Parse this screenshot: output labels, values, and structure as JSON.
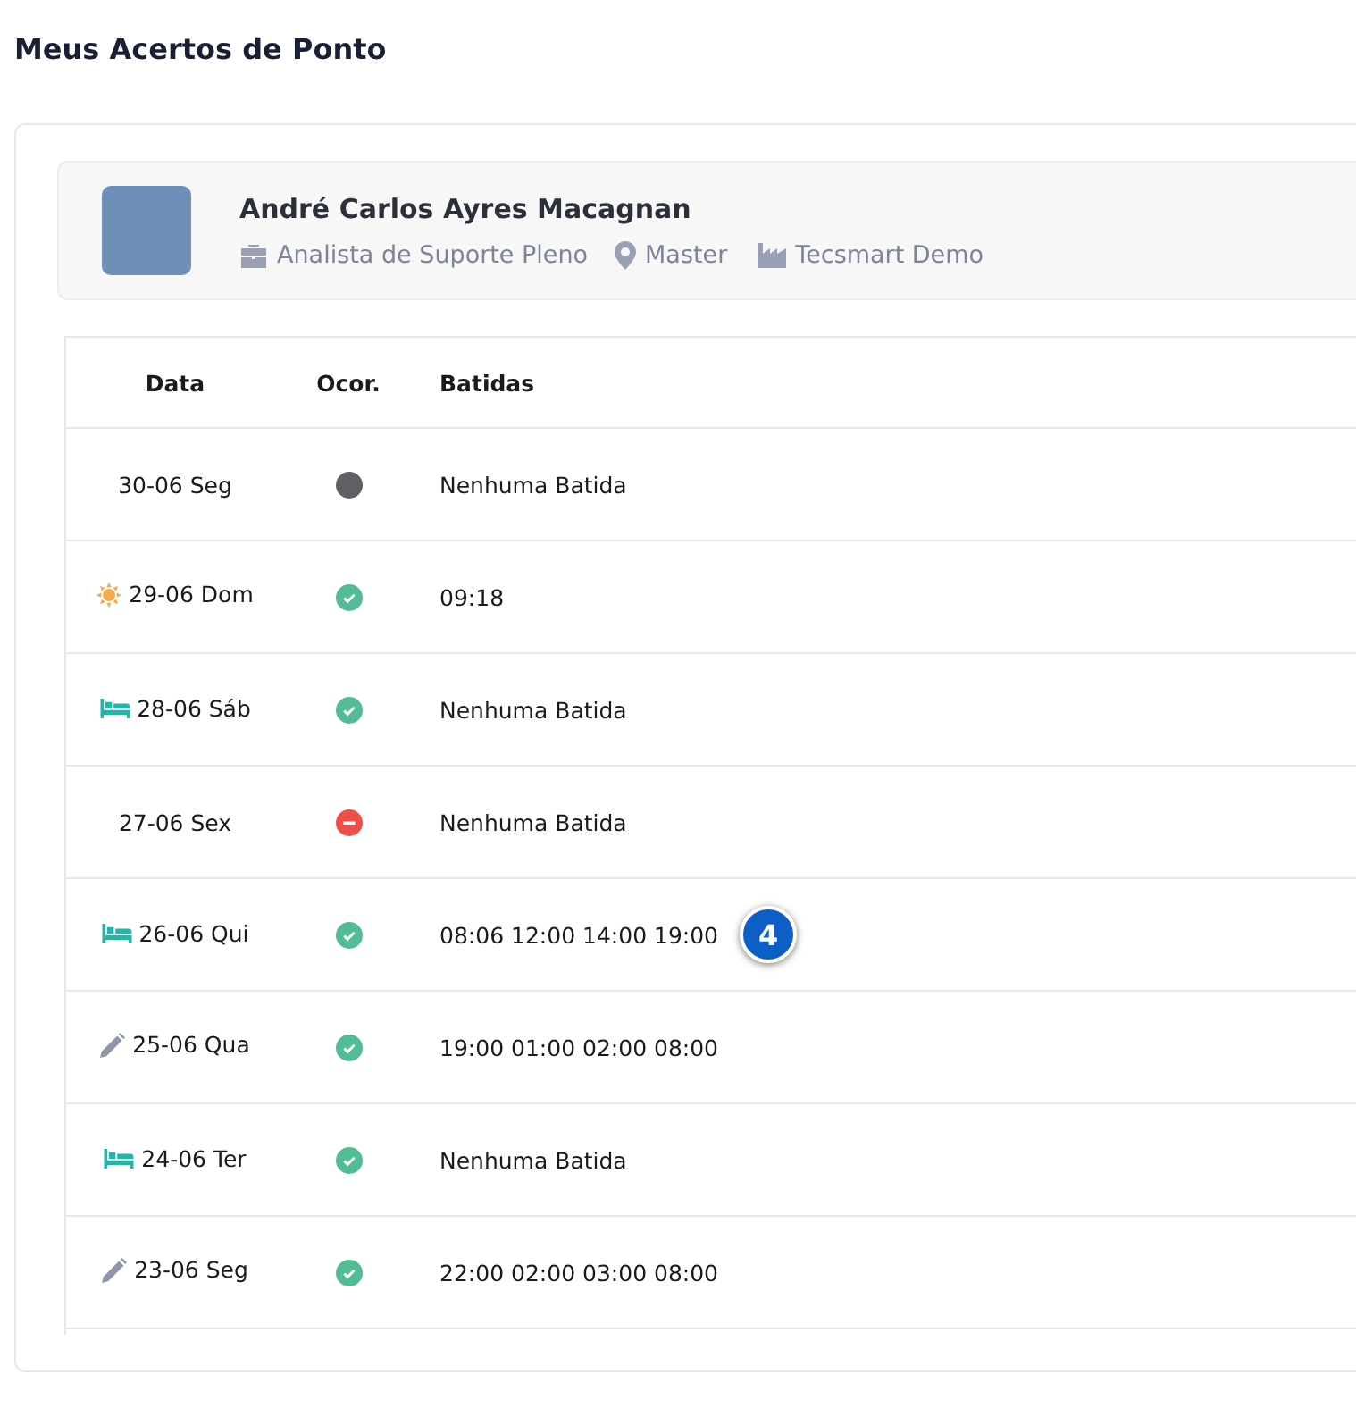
{
  "page_title": "Meus Acertos de Ponto",
  "employee": {
    "name": "André Carlos Ayres Macagnan",
    "role": "Analista de Suporte Pleno",
    "location": "Master",
    "company": "Tecsmart Demo"
  },
  "table": {
    "columns": [
      "Data",
      "Ocor.",
      "Batidas"
    ],
    "rows": [
      {
        "date": "30-06 Seg",
        "day_icon": {
          "kind": "none"
        },
        "status": {
          "kind": "empty"
        },
        "punches": "Nenhuma Batida"
      },
      {
        "date": "29-06 Dom",
        "day_icon": {
          "kind": "sun"
        },
        "status": {
          "kind": "ok"
        },
        "punches": "09:18"
      },
      {
        "date": "28-06 Sáb",
        "day_icon": {
          "kind": "bed"
        },
        "status": {
          "kind": "ok"
        },
        "punches": "Nenhuma Batida"
      },
      {
        "date": "27-06 Sex",
        "day_icon": {
          "kind": "none"
        },
        "status": {
          "kind": "absent"
        },
        "punches": "Nenhuma Batida"
      },
      {
        "date": "26-06 Qui",
        "day_icon": {
          "kind": "bed"
        },
        "status": {
          "kind": "ok"
        },
        "punches": "08:06 12:00 14:00 19:00",
        "callout": "4"
      },
      {
        "date": "25-06 Qua",
        "day_icon": {
          "kind": "pencil"
        },
        "status": {
          "kind": "ok"
        },
        "punches": "19:00 01:00 02:00 08:00"
      },
      {
        "date": "24-06 Ter",
        "day_icon": {
          "kind": "bed"
        },
        "status": {
          "kind": "ok"
        },
        "punches": "Nenhuma Batida"
      },
      {
        "date": "23-06 Seg",
        "day_icon": {
          "kind": "pencil"
        },
        "status": {
          "kind": "ok"
        },
        "punches": "22:00 02:00 03:00 08:00"
      }
    ]
  }
}
